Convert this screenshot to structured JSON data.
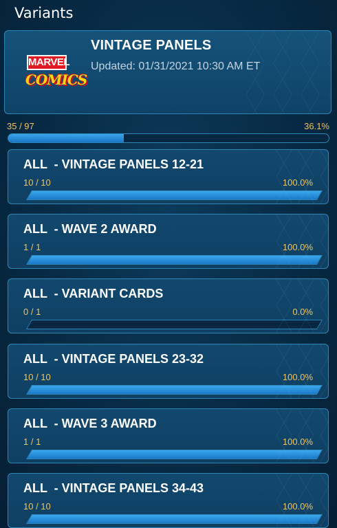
{
  "page": {
    "title": "Variants"
  },
  "header": {
    "logo_top": "MARVEL",
    "logo_bottom": "COMICS",
    "title": "VINTAGE PANELS",
    "updated": "Updated: 01/31/2021 10:30 AM ET"
  },
  "overall": {
    "count": "35 / 97",
    "percent_label": "36.1%",
    "fill_fraction": 0.361
  },
  "groups": [
    {
      "title": "ALL  - VINTAGE PANELS 12-21",
      "count": "10 / 10",
      "percent_label": "100.0%",
      "fill_fraction": 1.0
    },
    {
      "title": "ALL  - WAVE 2 AWARD",
      "count": "1 / 1",
      "percent_label": "100.0%",
      "fill_fraction": 1.0
    },
    {
      "title": "ALL  - VARIANT CARDS",
      "count": "0 / 1",
      "percent_label": "0.0%",
      "fill_fraction": 0.0
    },
    {
      "title": "ALL  - VINTAGE PANELS 23-32",
      "count": "10 / 10",
      "percent_label": "100.0%",
      "fill_fraction": 1.0
    },
    {
      "title": "ALL  - WAVE 3 AWARD",
      "count": "1 / 1",
      "percent_label": "100.0%",
      "fill_fraction": 1.0
    },
    {
      "title": "ALL  - VINTAGE PANELS 34-43",
      "count": "10 / 10",
      "percent_label": "100.0%",
      "fill_fraction": 1.0
    }
  ],
  "colors": {
    "accent_gold": "#f1c55f",
    "bar_blue": "#2a8ddc",
    "card_border": "#2e86b4"
  }
}
